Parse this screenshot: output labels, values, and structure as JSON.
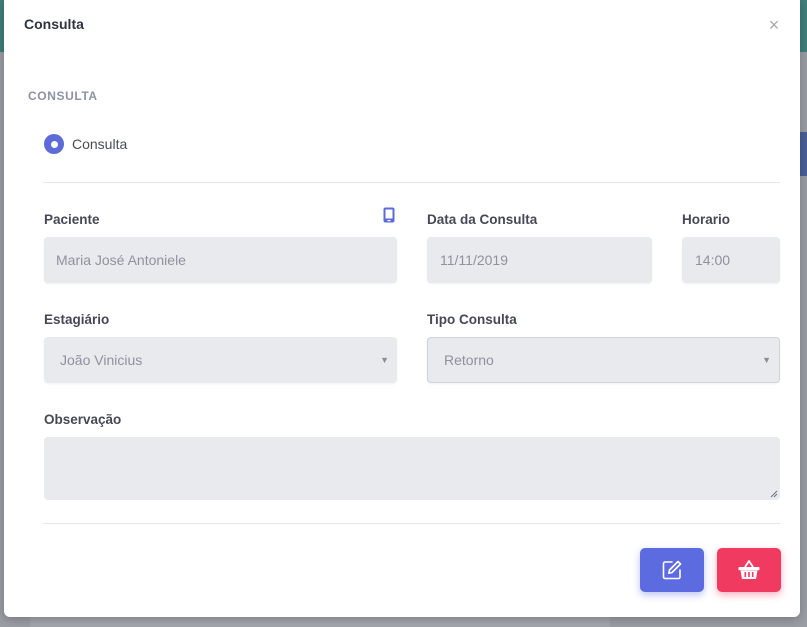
{
  "modal": {
    "title": "Consulta",
    "close_label": "×",
    "section_label": "CONSULTA",
    "radio_label": "Consulta"
  },
  "form": {
    "paciente": {
      "label": "Paciente",
      "value": "Maria José Antoniele"
    },
    "data_consulta": {
      "label": "Data da Consulta",
      "value": "11/11/2019"
    },
    "horario": {
      "label": "Horario",
      "value": "14:00"
    },
    "estagiario": {
      "label": "Estagiário",
      "value": "João Vinicius"
    },
    "tipo_consulta": {
      "label": "Tipo Consulta",
      "value": "Retorno"
    },
    "observacao": {
      "label": "Observação",
      "value": ""
    }
  },
  "icons": {
    "phone": "mobile-phone-icon",
    "edit": "edit-icon",
    "delete": "basket-icon",
    "dropdown": "caret-down-icon"
  },
  "colors": {
    "accent": "#5c6bd7",
    "danger": "#f03a5f"
  }
}
